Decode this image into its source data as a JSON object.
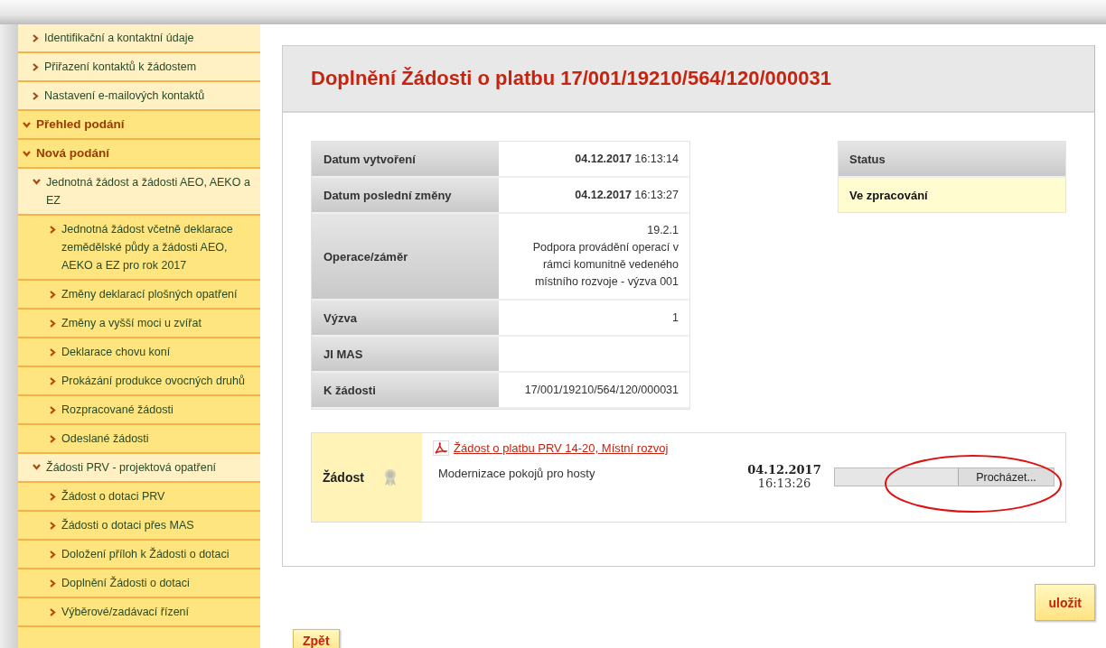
{
  "menu": [
    {
      "kind": "link",
      "label": "Identifikační a kontaktní údaje"
    },
    {
      "kind": "link",
      "label": "Přiřazení kontaktů k žádostem"
    },
    {
      "kind": "link",
      "label": "Nastavení e-mailových kontaktů"
    },
    {
      "kind": "section",
      "label": "Přehled podání",
      "expanded": true
    },
    {
      "kind": "section",
      "label": "Nová podání",
      "expanded": true,
      "children": [
        {
          "kind": "group",
          "label": "Jednotná žádost a žádosti AEO, AEKO a EZ",
          "expanded": true,
          "children": [
            {
              "kind": "link",
              "label": "Jednotná žádost včetně deklarace zemědělské půdy a žádosti AEO, AEKO a EZ pro rok 2017"
            },
            {
              "kind": "link",
              "label": "Změny deklarací plošných opatření"
            },
            {
              "kind": "link",
              "label": "Změny a vyšší moci u zvířat"
            },
            {
              "kind": "link",
              "label": "Deklarace chovu koní"
            },
            {
              "kind": "link",
              "label": "Prokázání produkce ovocných druhů"
            },
            {
              "kind": "link",
              "label": "Rozpracované žádosti"
            },
            {
              "kind": "link",
              "label": "Odeslané žádosti"
            }
          ]
        },
        {
          "kind": "group",
          "label": "Žádosti PRV - projektová opatření",
          "expanded": true,
          "children": [
            {
              "kind": "link",
              "label": "Žádost o dotaci PRV"
            },
            {
              "kind": "link",
              "label": "Žádosti o dotaci přes MAS"
            },
            {
              "kind": "link",
              "label": "Doložení příloh k Žádosti o dotaci"
            },
            {
              "kind": "link",
              "label": "Doplnění Žádosti o dotaci"
            },
            {
              "kind": "link",
              "label": "Výběrové/zadávací řízení"
            }
          ]
        }
      ]
    }
  ],
  "title": "Doplnění Žádosti o platbu 17/001/19210/564/120/000031",
  "details": [
    {
      "label": "Datum vytvoření",
      "value": "**04.12.2017** 16:13:14"
    },
    {
      "label": "Datum poslední změny",
      "value": "**04.12.2017** 16:13:27"
    },
    {
      "label": "Operace/záměr",
      "value": [
        "19.2.1",
        "Podpora provádění operací v rámci komunitně vedeného místního rozvoje - výzva 001"
      ]
    },
    {
      "label": "Výzva",
      "value": "1"
    },
    {
      "label": "JI MAS"
    },
    {
      "label": "K žádosti",
      "value": "17/001/19210/564/120/000031"
    }
  ],
  "status": {
    "heading": "Status",
    "value": "Ve zpracování"
  },
  "attachment": {
    "label": "Žádost",
    "link": "Žádost o platbu PRV 14-20, Místní rozvoj",
    "description": "Modernizace pokojů pro hosty",
    "date": "04.12.2017",
    "time": "16:13:26",
    "browse_button": "Procházet..."
  },
  "buttons": {
    "save": "uložit",
    "back": "Zpět"
  }
}
